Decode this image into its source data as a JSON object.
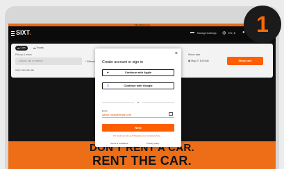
{
  "step_badge": "1",
  "system_bar": "7:51 AM   sixt.com",
  "nav": {
    "logo": "SIXT",
    "manage_bookings": "Manage bookings",
    "region": "EN | $"
  },
  "search": {
    "tabs": [
      {
        "label": "Cars"
      },
      {
        "label": "Trucks"
      }
    ],
    "pickup_label": "Pick-up & return",
    "pickup_placeholder": "Airport, city or address",
    "add_return": "+ Different return location",
    "pickup_date_label": "Pick-up date",
    "return_date_label": "Return date",
    "pickup_date": "May 26  12:00 PM",
    "return_date": "May 27   8:30 AM",
    "show_cars": "Show cars",
    "corporate_link": "Apply corporate rate"
  },
  "modal": {
    "title": "Create account or sign in",
    "apple_label": "Continue with Apple",
    "google_label": "Continue with Google",
    "or": "or",
    "email_label": "Email",
    "email_value": "aaron.rossi@email.com",
    "next_label": "Next",
    "register_link": "No business rate yet? Register your company here →",
    "terms": "Terms & conditions",
    "privacy": "Privacy policy"
  },
  "hero": {
    "line1": "DON'T RENT A CAR.",
    "line2": "RENT THE CAR."
  },
  "colors": {
    "accent": "#ff5f00",
    "hero": "#ee6d17",
    "dark": "#131313"
  }
}
